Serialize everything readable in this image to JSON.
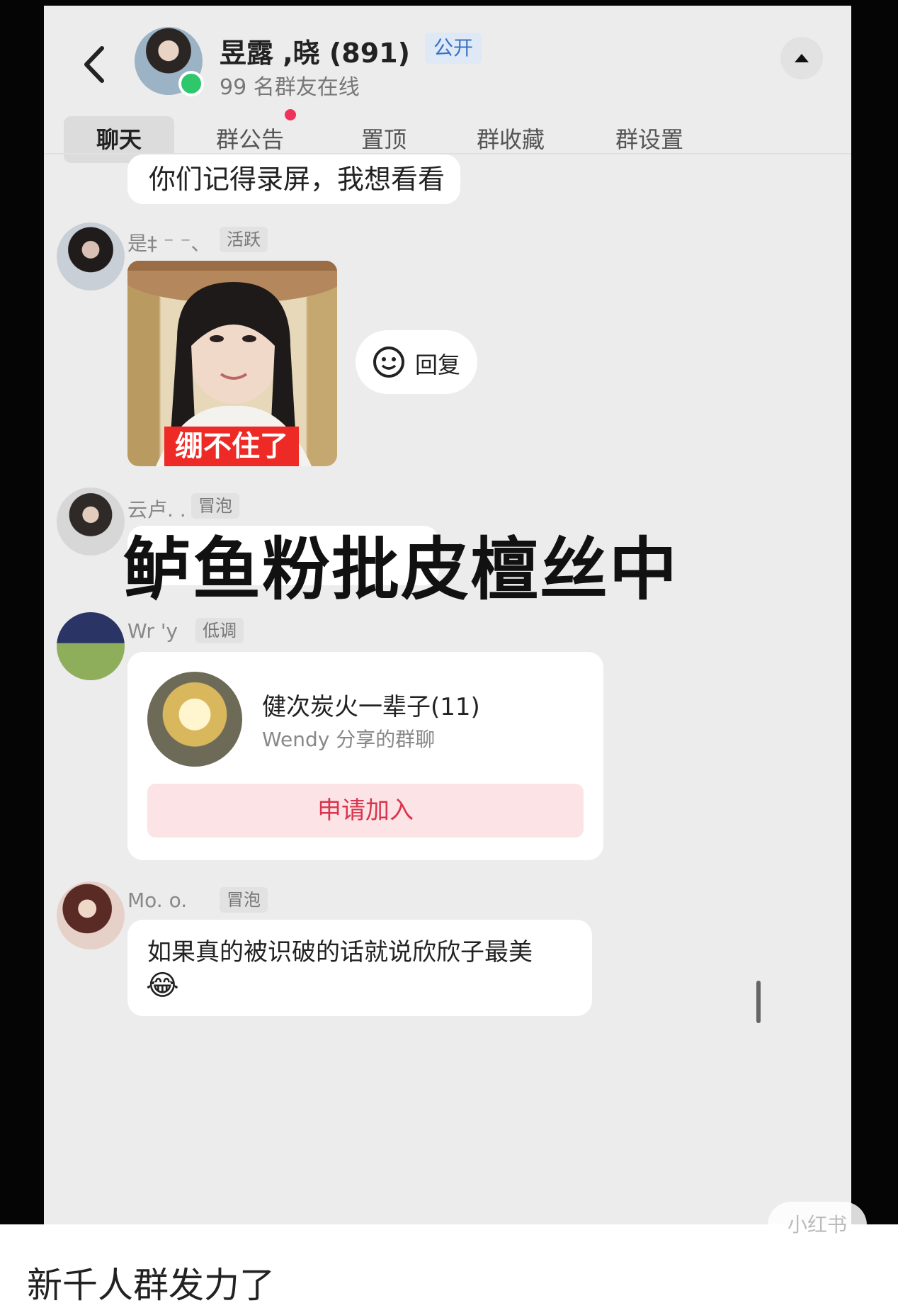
{
  "header": {
    "title": "昱露   ,晓 (891)",
    "badge": "公开",
    "subtitle": "99 名群友在线"
  },
  "tabs": [
    {
      "label": "聊天",
      "active": true
    },
    {
      "label": "群公告",
      "has_dot": true
    },
    {
      "label": "置顶"
    },
    {
      "label": "群收藏"
    },
    {
      "label": "群设置"
    }
  ],
  "messages": {
    "m1_text": "你们记得录屏，我想看看",
    "m2_name": "是‡  ⁻  ⁻、",
    "m2_tag": "活跃",
    "m2_caption": "绷不住了",
    "reply_label": "回复",
    "m3_name": "云卢.  .",
    "m3_tag": "冒泡",
    "overlay": "鲈鱼粉批皮檀丝中",
    "m4_name": "Wr   'y",
    "m4_tag": "低调",
    "card_title": "健次炭火一辈子(11)",
    "card_sub": "Wendy 分享的群聊",
    "card_button": "申请加入",
    "m5_name": "Mo.     o.",
    "m5_tag": "冒泡",
    "m5_text": "如果真的被识破的话就说欣欣子最美",
    "m5_emoji": "😂"
  },
  "watermark": "小红书",
  "post_caption": "新千人群发力了",
  "colors": {
    "online": "#2ec76b",
    "badge_text": "#3a72c6",
    "join_text": "#d9354d",
    "caption_bg": "#ee2a26"
  }
}
